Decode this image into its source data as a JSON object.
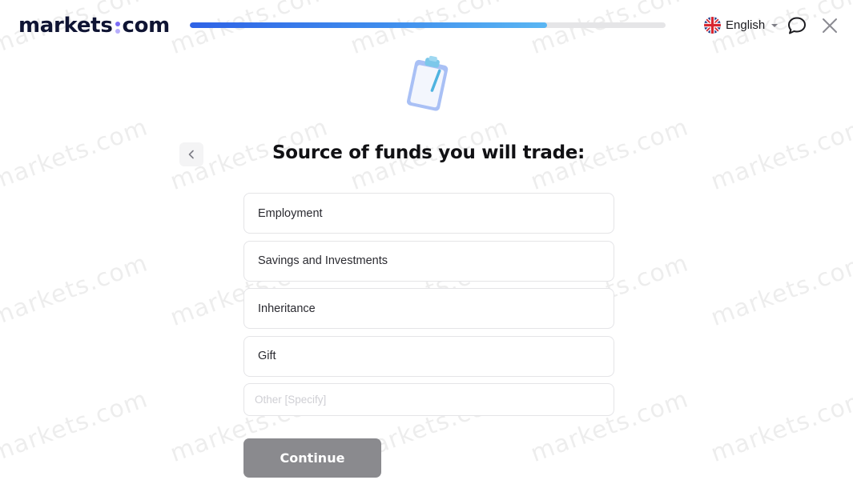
{
  "header": {
    "logo_left": "markets",
    "logo_right": "com",
    "progress_percent": 75,
    "language": {
      "label": "English",
      "flag_icon": "uk-flag-icon"
    },
    "chat_icon": "chat-bubble-icon",
    "close_icon": "close-icon"
  },
  "illustration": {
    "icon": "clipboard-icon"
  },
  "page": {
    "back_icon": "chevron-left-icon",
    "title": "Source of funds you will trade:"
  },
  "options": [
    {
      "label": "Employment"
    },
    {
      "label": "Savings and Investments"
    },
    {
      "label": "Inheritance"
    },
    {
      "label": "Gift"
    }
  ],
  "other": {
    "value": "",
    "placeholder": "Other [Specify]"
  },
  "actions": {
    "continue_label": "Continue"
  },
  "watermark_text": "markets.com",
  "colors": {
    "brand_dark": "#0f1433",
    "brand_accent": "#7b6cf6",
    "progress_start": "#2f63e6",
    "progress_end": "#5ab6f3",
    "continue_disabled": "#8a8a8e"
  }
}
